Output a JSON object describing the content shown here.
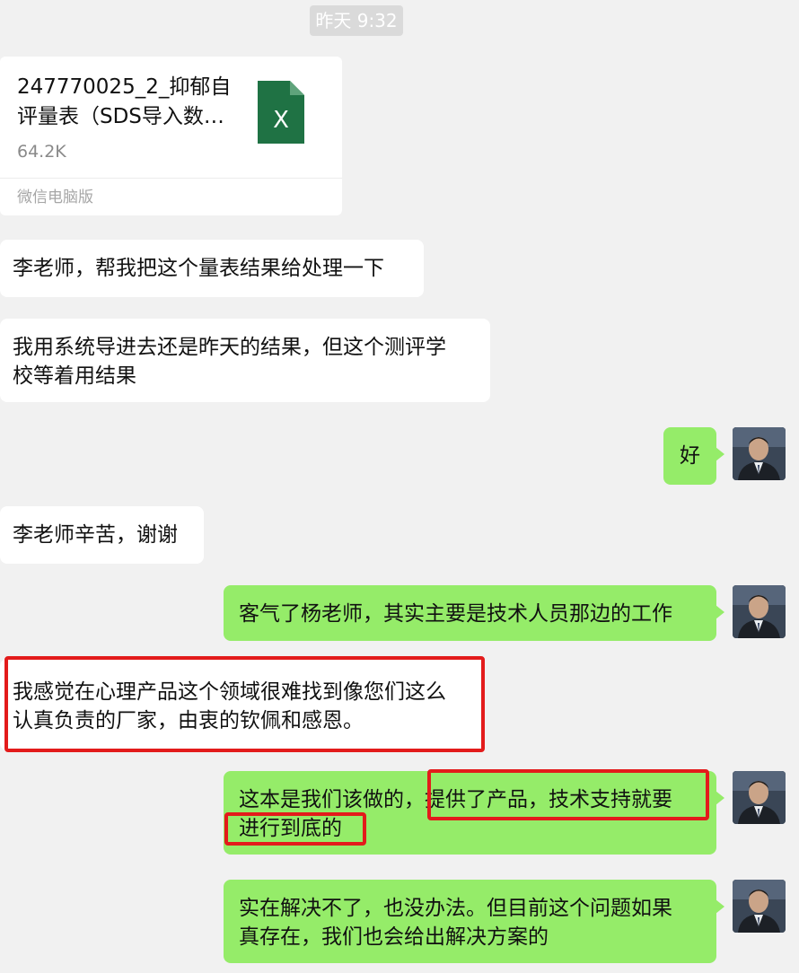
{
  "timestamp": "昨天 9:32",
  "file_card": {
    "name": "247770025_2_抑郁自评量表（SDS导入数…",
    "size": "64.2K",
    "source": "微信电脑版",
    "icon": "excel-icon",
    "icon_letter": "X",
    "icon_color": "#1f7244"
  },
  "messages": [
    {
      "side": "left",
      "text_lines": [
        "李老师，帮我把这个量表结果给处理一下"
      ]
    },
    {
      "side": "left",
      "text_lines": [
        "我用系统导进去还是昨天的结果，但这个测评学",
        "校等着用结果"
      ]
    },
    {
      "side": "right",
      "text_lines": [
        "好"
      ]
    },
    {
      "side": "left",
      "text_lines": [
        "李老师辛苦，谢谢"
      ]
    },
    {
      "side": "right",
      "text_lines": [
        "客气了杨老师，其实主要是技术人员那边的工作"
      ]
    },
    {
      "side": "left",
      "text_lines": [
        "我感觉在心理产品这个领域很难找到像您们这么",
        "认真负责的厂家，由衷的钦佩和感恩。"
      ]
    },
    {
      "side": "right",
      "text_lines": [
        "这本是我们该做的，提供了产品，技术支持就要",
        "进行到底的"
      ]
    },
    {
      "side": "right",
      "text_lines": [
        "实在解决不了，也没办法。但目前这个问题如果",
        "真存在，我们也会给出解决方案的"
      ]
    }
  ],
  "colors": {
    "background": "#f1f1f1",
    "sent_bubble": "#95ec69",
    "received_bubble": "#ffffff",
    "highlight": "#e31b1b"
  }
}
